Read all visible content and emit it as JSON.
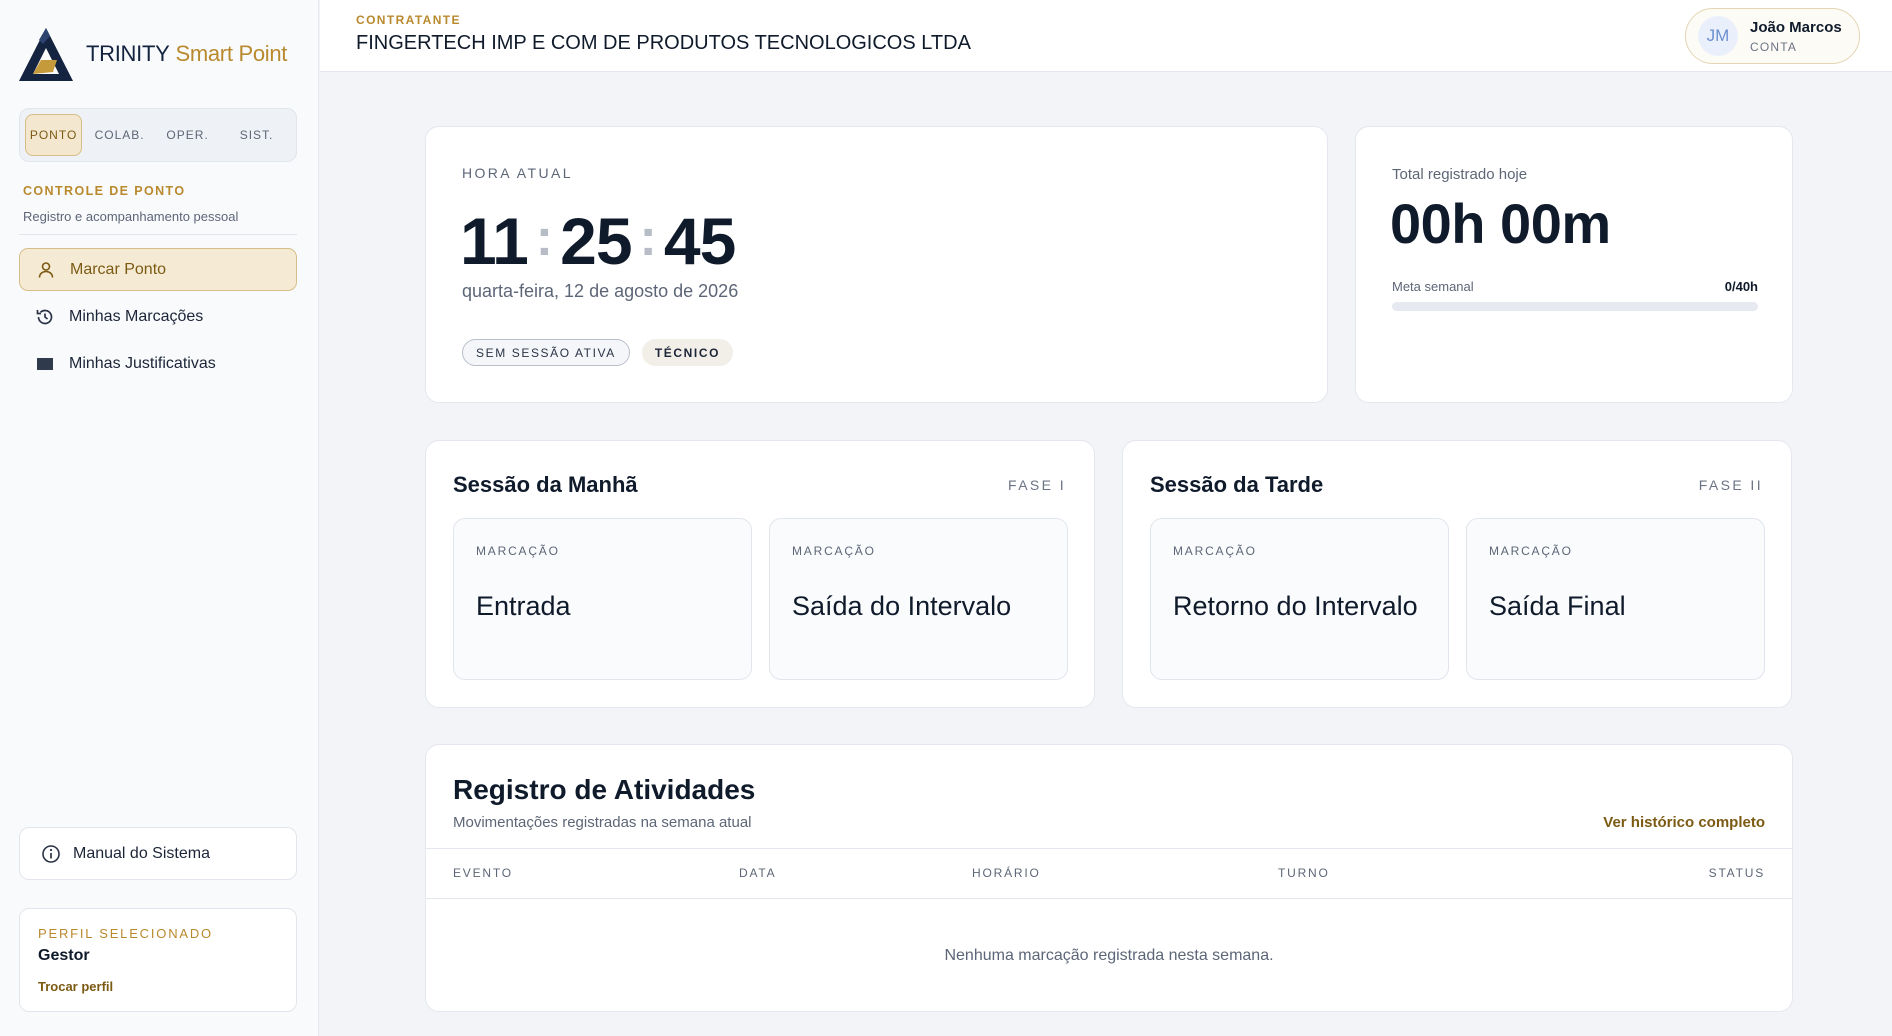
{
  "brand": {
    "name1": "TRINITY",
    "name2": "Smart Point"
  },
  "module_tabs": [
    "PONTO",
    "COLAB.",
    "OPER.",
    "SIST."
  ],
  "sidebar": {
    "section_title": "CONTROLE DE PONTO",
    "section_sub": "Registro e acompanhamento pessoal",
    "items": [
      {
        "label": "Marcar Ponto",
        "icon": "user-icon"
      },
      {
        "label": "Minhas Marcações",
        "icon": "history-icon"
      },
      {
        "label": "Minhas Justificativas",
        "icon": "document-icon"
      }
    ],
    "manual": "Manual do Sistema",
    "profile": {
      "label": "PERFIL SELECIONADO",
      "value": "Gestor",
      "switch": "Trocar perfil"
    }
  },
  "header": {
    "contractor_label": "CONTRATANTE",
    "contractor_name": "FINGERTECH IMP E COM DE PRODUTOS TECNOLOGICOS LTDA",
    "user": {
      "initials": "JM",
      "name": "João Marcos",
      "role": "CONTA"
    }
  },
  "clock": {
    "label": "HORA ATUAL",
    "hh": "11",
    "mm": "25",
    "ss": "45",
    "sep": ":",
    "date": "quarta-feira, 12 de agosto de 2026",
    "chips": [
      "SEM SESSÃO ATIVA",
      "TÉCNICO"
    ]
  },
  "total": {
    "label": "Total registrado hoje",
    "value": "00h 00m",
    "meta_label": "Meta semanal",
    "meta_value": "0/40h",
    "progress": 0
  },
  "sessions": {
    "morning": {
      "title": "Sessão da Manhã",
      "phase": "FASE I",
      "marks": [
        {
          "label": "MARCAÇÃO",
          "name": "Entrada"
        },
        {
          "label": "MARCAÇÃO",
          "name": "Saída do Intervalo"
        }
      ]
    },
    "afternoon": {
      "title": "Sessão da Tarde",
      "phase": "FASE II",
      "marks": [
        {
          "label": "MARCAÇÃO",
          "name": "Retorno do Intervalo"
        },
        {
          "label": "MARCAÇÃO",
          "name": "Saída Final"
        }
      ]
    }
  },
  "activity": {
    "title": "Registro de Atividades",
    "subtitle": "Movimentações registradas na semana atual",
    "link": "Ver histórico completo",
    "columns": [
      "EVENTO",
      "DATA",
      "HORÁRIO",
      "TURNO",
      "STATUS"
    ],
    "empty": "Nenhuma marcação registrada nesta semana."
  },
  "colors": {
    "accent": "#b9892d",
    "navy": "#14233f"
  }
}
